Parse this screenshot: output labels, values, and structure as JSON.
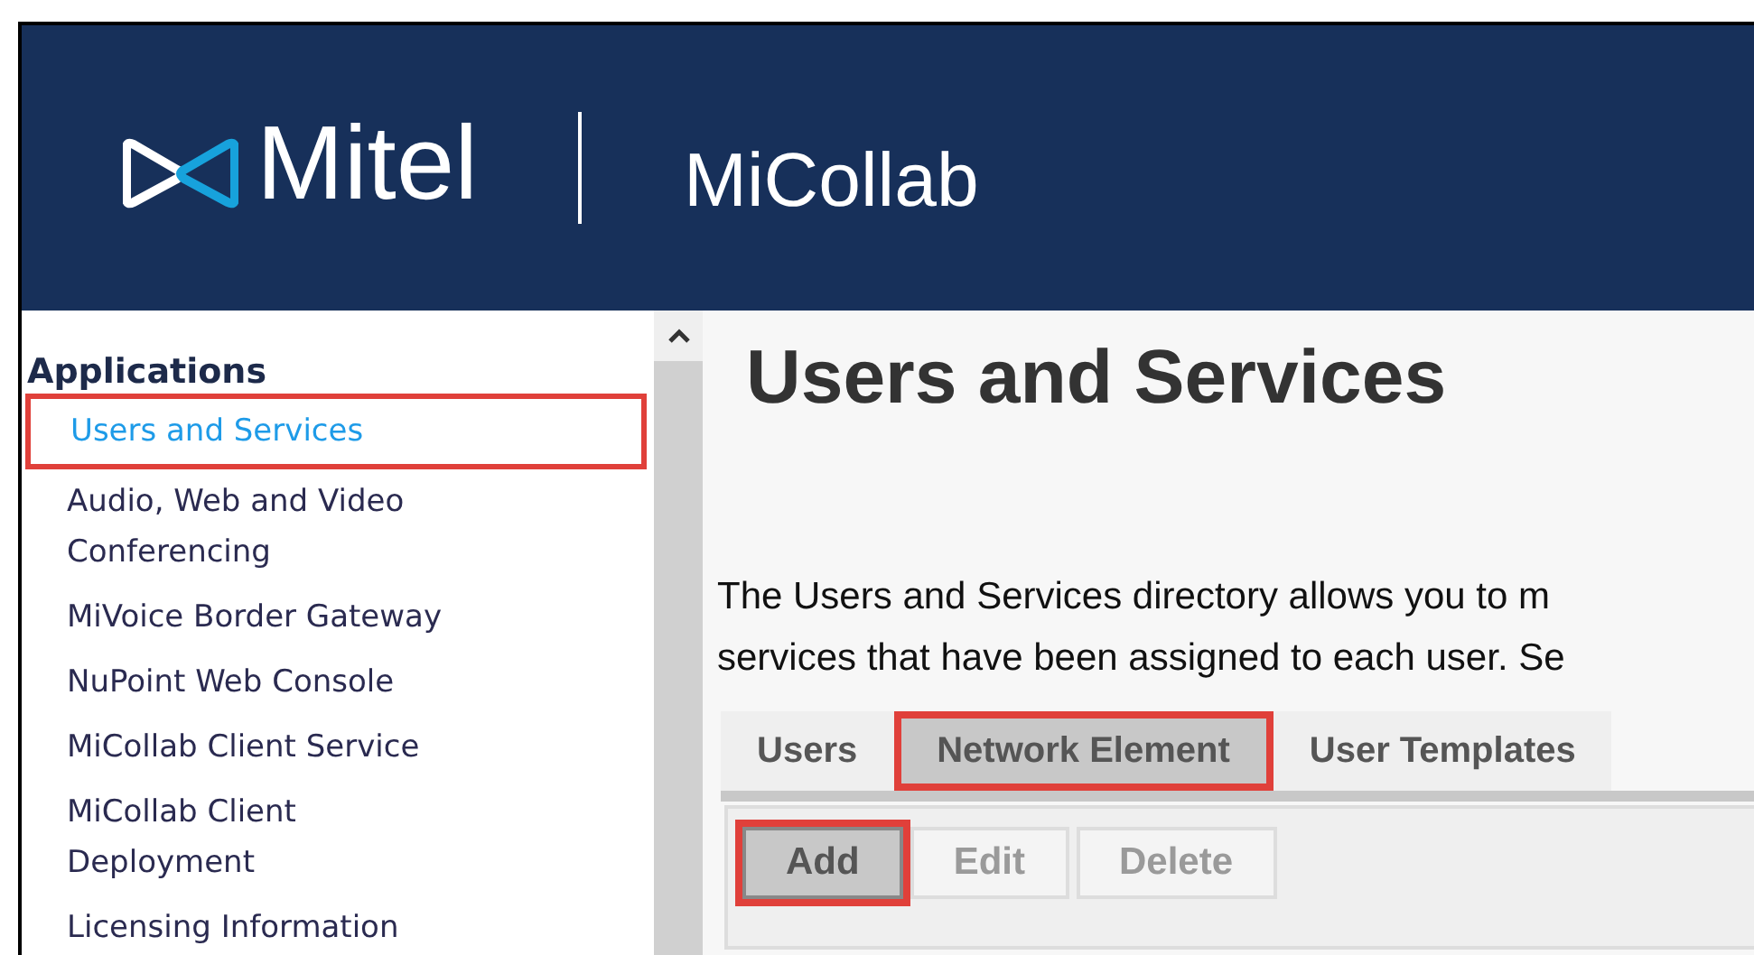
{
  "header": {
    "brand": "Mitel",
    "product": "MiCollab"
  },
  "sidebar": {
    "title": "Applications",
    "items": [
      {
        "label": "Users and Services",
        "selected": true,
        "highlighted": true
      },
      {
        "label": "Audio, Web and Video Conferencing",
        "selected": false,
        "highlighted": false
      },
      {
        "label": "MiVoice Border Gateway",
        "selected": false,
        "highlighted": false
      },
      {
        "label": "NuPoint Web Console",
        "selected": false,
        "highlighted": false
      },
      {
        "label": "MiCollab Client Service",
        "selected": false,
        "highlighted": false
      },
      {
        "label": "MiCollab Client Deployment",
        "selected": false,
        "highlighted": false
      },
      {
        "label": "Licensing Information",
        "selected": false,
        "highlighted": false
      }
    ]
  },
  "main": {
    "title": "Users and Services",
    "description": [
      "The Users and Services directory allows you to m",
      "services that have been assigned to each user. Se"
    ],
    "tabs": [
      {
        "label": "Users",
        "selected": false,
        "highlighted": false
      },
      {
        "label": "Network Element",
        "selected": true,
        "highlighted": true
      },
      {
        "label": "User Templates",
        "selected": false,
        "highlighted": false
      }
    ],
    "buttons": [
      {
        "label": "Add",
        "disabled": false,
        "highlighted": true
      },
      {
        "label": "Edit",
        "disabled": true,
        "highlighted": false
      },
      {
        "label": "Delete",
        "disabled": true,
        "highlighted": false
      }
    ]
  }
}
